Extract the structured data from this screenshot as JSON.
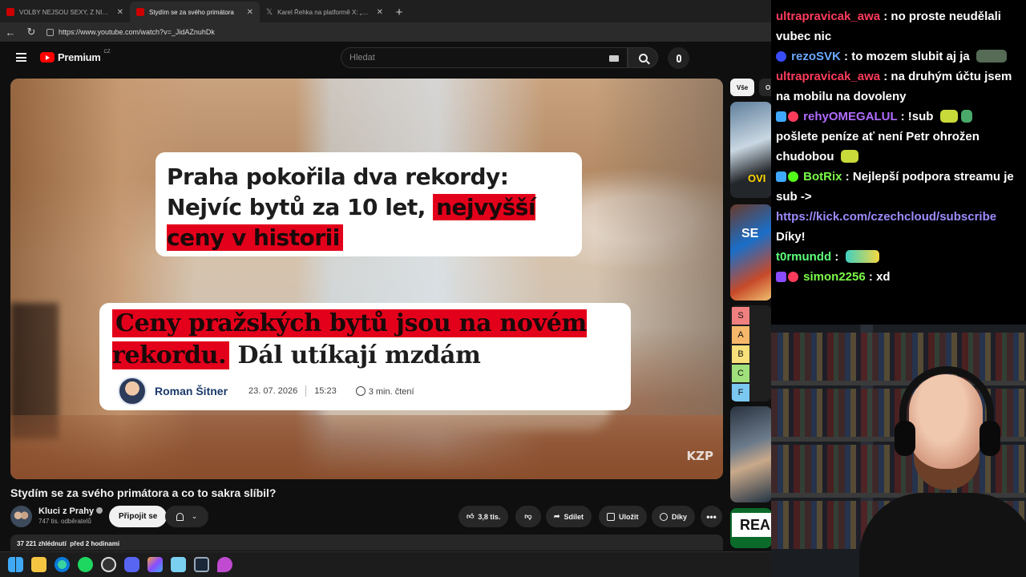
{
  "browser": {
    "tabs": [
      {
        "title": "VOLBY NEJSOU SEXY, Z NICH NEMÁ",
        "active": false
      },
      {
        "title": "Stydím se za svého primátora",
        "active": true
      },
      {
        "title": "Karel Řehka na platformě X: „Po v",
        "active": false
      }
    ],
    "url": "https://www.youtube.com/watch?v=_JidAZnuhDk"
  },
  "youtube": {
    "brand": "Premium",
    "region": "CZ",
    "search_placeholder": "Hledat"
  },
  "video": {
    "headline1_plain": "Praha pokořila dva rekordy: Nejvíc bytů za 10 let, ",
    "headline1_marked": "nejvyšší ceny v historii",
    "headline2_marked": "Ceny pražských bytů jsou na novém rekordu.",
    "headline2_plain": " Dál utíkají mzdám",
    "author": "Roman Šitner",
    "date": "23. 07. 2026",
    "time": "15:23",
    "read_time": "3 min. čtení",
    "watermark": "KZP"
  },
  "meta": {
    "title": "Stydím se za svého primátora a co to sakra slíbil?",
    "channel": "Kluci z Prahy",
    "subscribers": "747 tis. odběratelů",
    "join_label": "Připojit se",
    "likes": "3,8 tis.",
    "share_label": "Sdílet",
    "save_label": "Uložit",
    "thanks_label": "Díky",
    "more_label": "•••",
    "views": "37 221 zhlédnutí",
    "posted": "před 2 hodinami"
  },
  "rail": {
    "chip_all": "Vše",
    "chip_other": "O",
    "thumb1_text": "OVI",
    "thumb2_text": "SE",
    "tiers": [
      "S",
      "A",
      "B",
      "C",
      "F"
    ],
    "thumb5_text": "REA"
  },
  "chat": [
    {
      "user": "ultrapravicak_awa",
      "color": "#ff3b5c",
      "text": "no proste neudělali vubec nic",
      "badges": []
    },
    {
      "user": "rezoSVK",
      "color": "#6aa9ff",
      "text": "to mozem slubit aj ja",
      "badges": [
        "#3a4cff"
      ]
    },
    {
      "user": "ultrapravicak_awa",
      "color": "#ff3b5c",
      "text": "na druhým účtu jsem na mobilu na dovoleny",
      "badges": []
    },
    {
      "user": "rehyOMEGALUL",
      "color": "#b16cff",
      "text": "!sub",
      "text2": "pošlete peníze ať není Petr ohrožen chudobou",
      "badges": [
        "#3fa9ff",
        "#ff3b5c"
      ]
    },
    {
      "user": "BotRix",
      "color": "#7cfc4a",
      "text": "Nejlepší podpora streamu je sub ->",
      "link": "https://kick.com/czechcloud/subscribe",
      "text2": "Díky!",
      "badges": [
        "#3fa9ff",
        "#53fc18"
      ]
    },
    {
      "user": "t0rmundd",
      "color": "#5dff7a",
      "text": "",
      "badges": []
    },
    {
      "user": "simon2256",
      "color": "#7cfc4a",
      "text": "xd",
      "badges": [
        "#8a4cff",
        "#ff3b5c"
      ]
    }
  ]
}
